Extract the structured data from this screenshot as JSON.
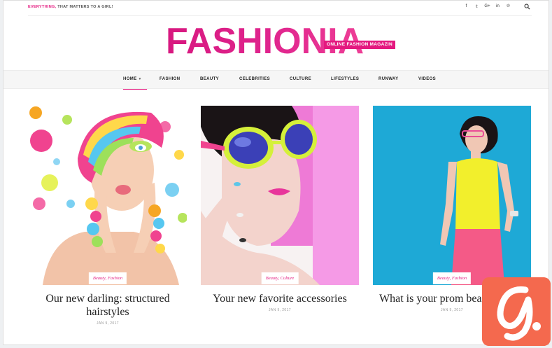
{
  "topbar": {
    "tagline_accent": "EVERYTHING,",
    "tagline_rest": " THAT MATTERS TO A GIRL!",
    "socials": [
      {
        "icon": "facebook-icon",
        "glyph": "f"
      },
      {
        "icon": "twitter-icon",
        "glyph": "𝕥"
      },
      {
        "icon": "google-plus-icon",
        "glyph": "G+"
      },
      {
        "icon": "linkedin-icon",
        "glyph": "in"
      },
      {
        "icon": "pinterest-icon",
        "glyph": "℗"
      }
    ]
  },
  "logo": {
    "text": "FASHIONIA",
    "subtitle": "ONLINE FASHION MAGAZIN"
  },
  "nav": {
    "items": [
      "HOME",
      "FASHION",
      "BEAUTY",
      "CELEBRITIES",
      "CULTURE",
      "LIFESTYLES",
      "RUNWAY",
      "VIDEOS"
    ],
    "active": "HOME"
  },
  "posts": [
    {
      "categories": "Beauty, Fashion",
      "title": "Our new darling: structured hairstyles",
      "date": "JAN 9, 2017"
    },
    {
      "categories": "Beauty, Culture",
      "title": "Your new favorite accessories",
      "date": "JAN 9, 2017"
    },
    {
      "categories": "Beauty, Fashion",
      "title": "What is your prom bea",
      "date": "JAN 9, 2017"
    }
  ],
  "colors": {
    "accent": "#e4197f",
    "nav_bg": "#f6f6f6",
    "corner_badge": "#f4694e"
  }
}
